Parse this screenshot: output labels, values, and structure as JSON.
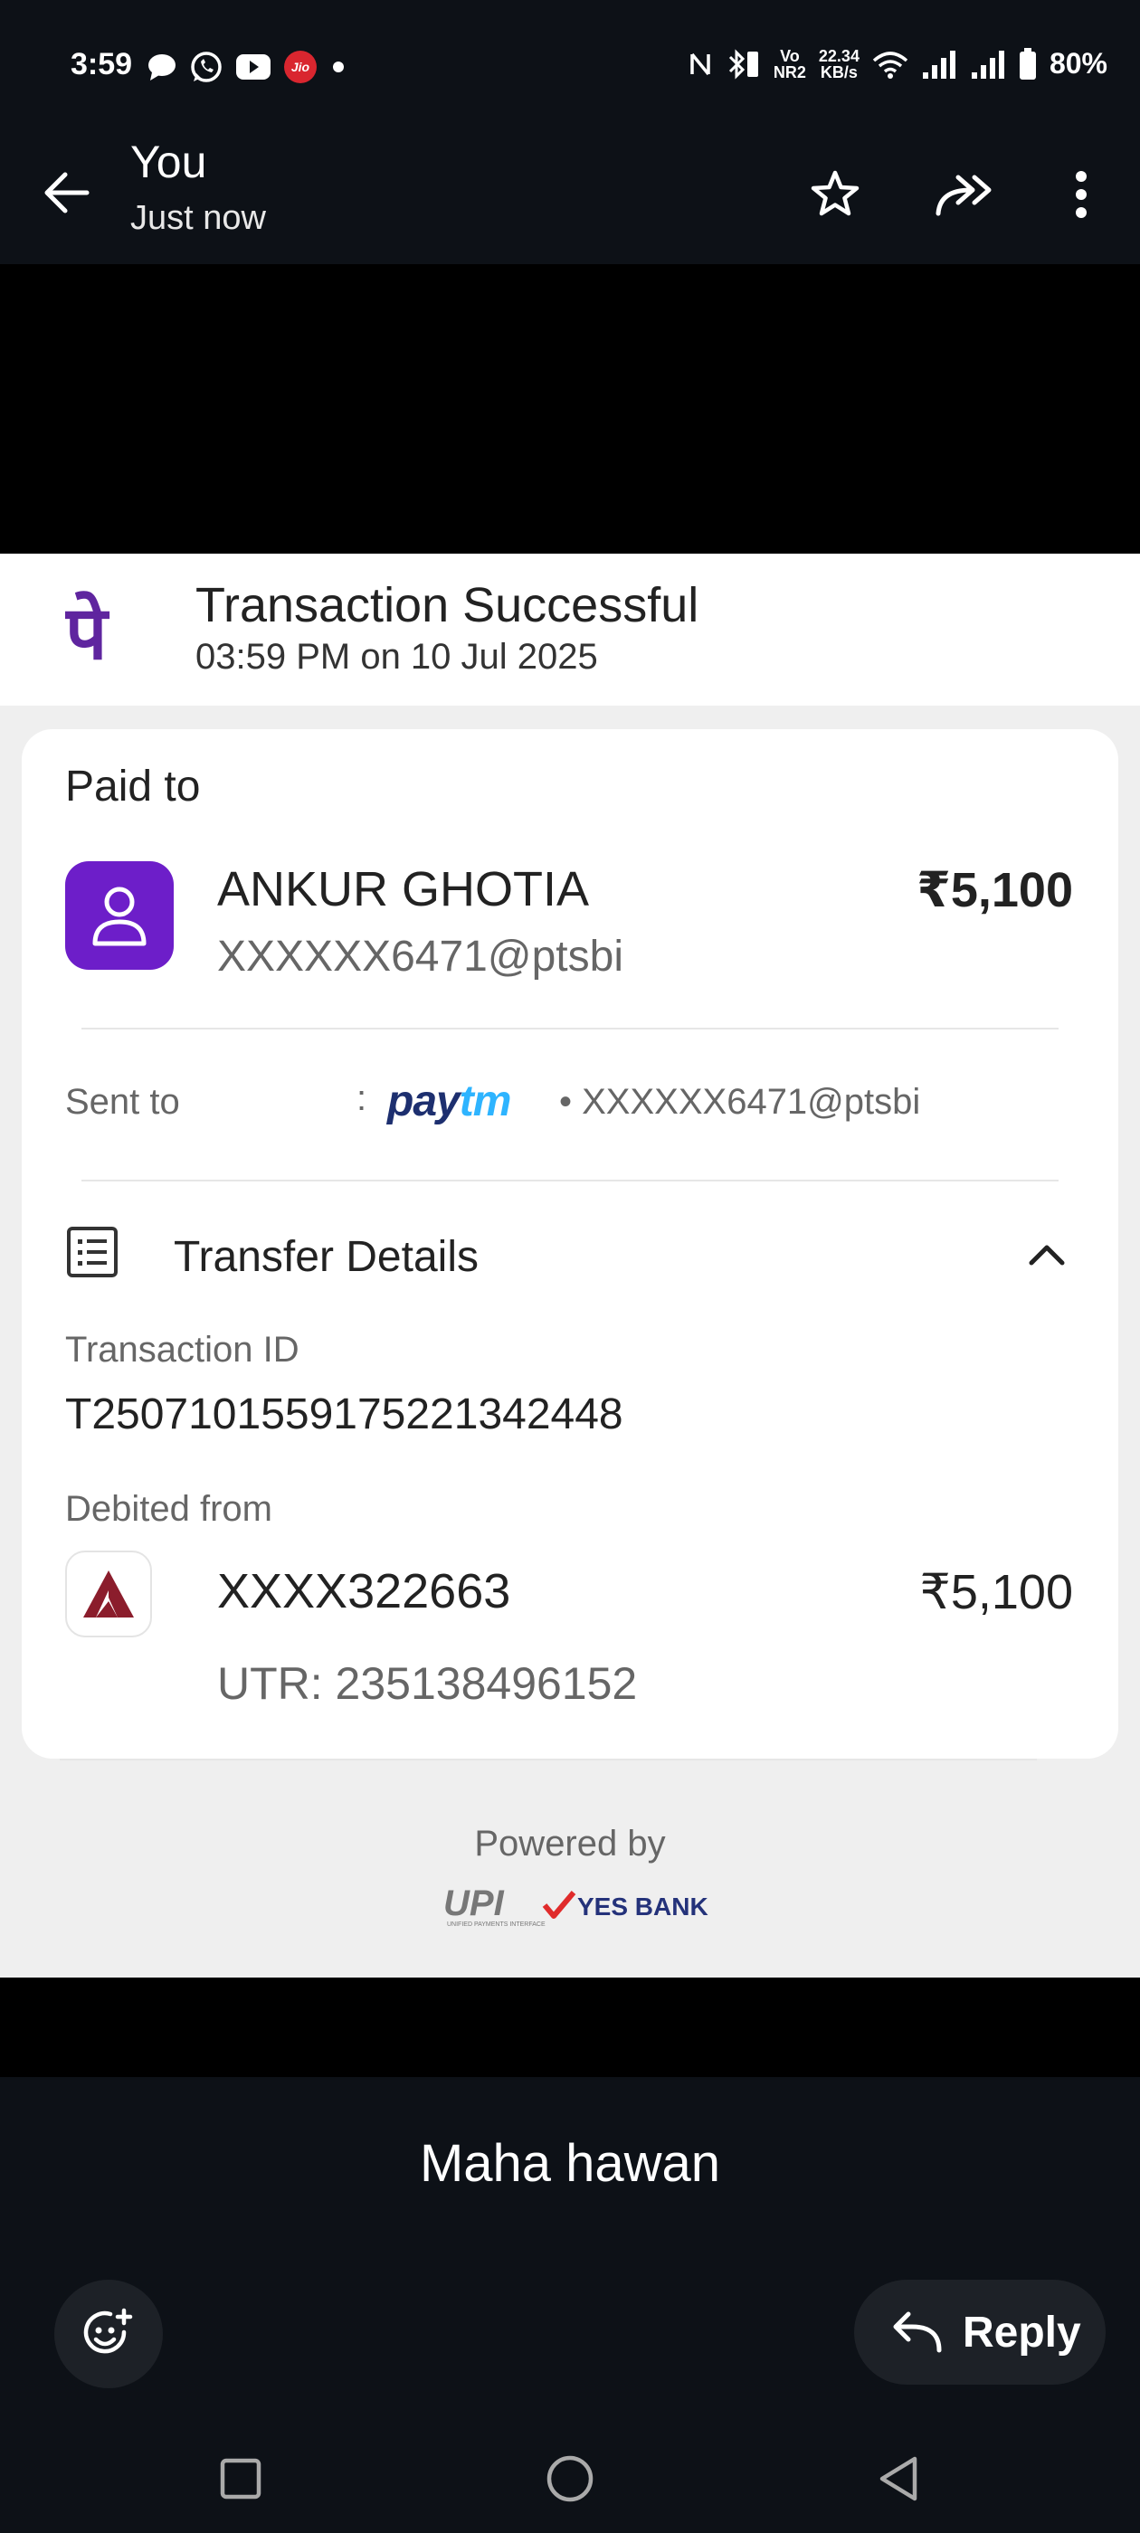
{
  "status_bar": {
    "time": "3:59",
    "notification_icons": [
      "chat-bubble-icon",
      "whatsapp-icon",
      "youtube-icon",
      "jio-icon",
      "dot-icon"
    ],
    "jio_label": "Jio",
    "data_speed_value": "22.34",
    "data_speed_unit": "KB/s",
    "vo_label": "Vo",
    "nr_label": "NR2",
    "battery": "80%"
  },
  "header": {
    "title": "You",
    "subtitle": "Just now",
    "actions": [
      "star-icon",
      "forward-icon",
      "more-vert-icon"
    ]
  },
  "receipt": {
    "status_title": "Transaction Successful",
    "datetime": "03:59 PM on 10 Jul 2025",
    "brand_glyph": "पे",
    "paid_to_label": "Paid to",
    "payee_name": "ANKUR GHOTIA",
    "payee_vpa": "XXXXXX6471@ptsbi",
    "amount": "₹5,100",
    "sent_to_label": "Sent to",
    "sent_colon": ":",
    "paytm_pay": "pay",
    "paytm_tm": "tm",
    "sent_to_vpa": "• XXXXXX6471@ptsbi",
    "transfer_details_title": "Transfer Details",
    "transaction_id_label": "Transaction ID",
    "transaction_id": "T2507101559175221342448",
    "debited_from_label": "Debited from",
    "account_number": "XXXX322663",
    "debited_amount": "₹5,100",
    "utr": "UTR: 235138496152",
    "powered_by": "Powered by",
    "upi_logo_text": "UPI",
    "upi_tagline": "UNIFIED PAYMENTS INTERFACE",
    "bank_logo_text": "YES BANK"
  },
  "message": {
    "caption": "Maha hawan",
    "reply_label": "Reply"
  },
  "colors": {
    "phonepe_purple": "#5f259f",
    "avatar_purple": "#6d1ec9",
    "paytm_dark": "#1d2f6f",
    "paytm_light": "#2eb4ff",
    "axis_maroon": "#8b1d2c",
    "dark_bg": "#0d1117"
  }
}
